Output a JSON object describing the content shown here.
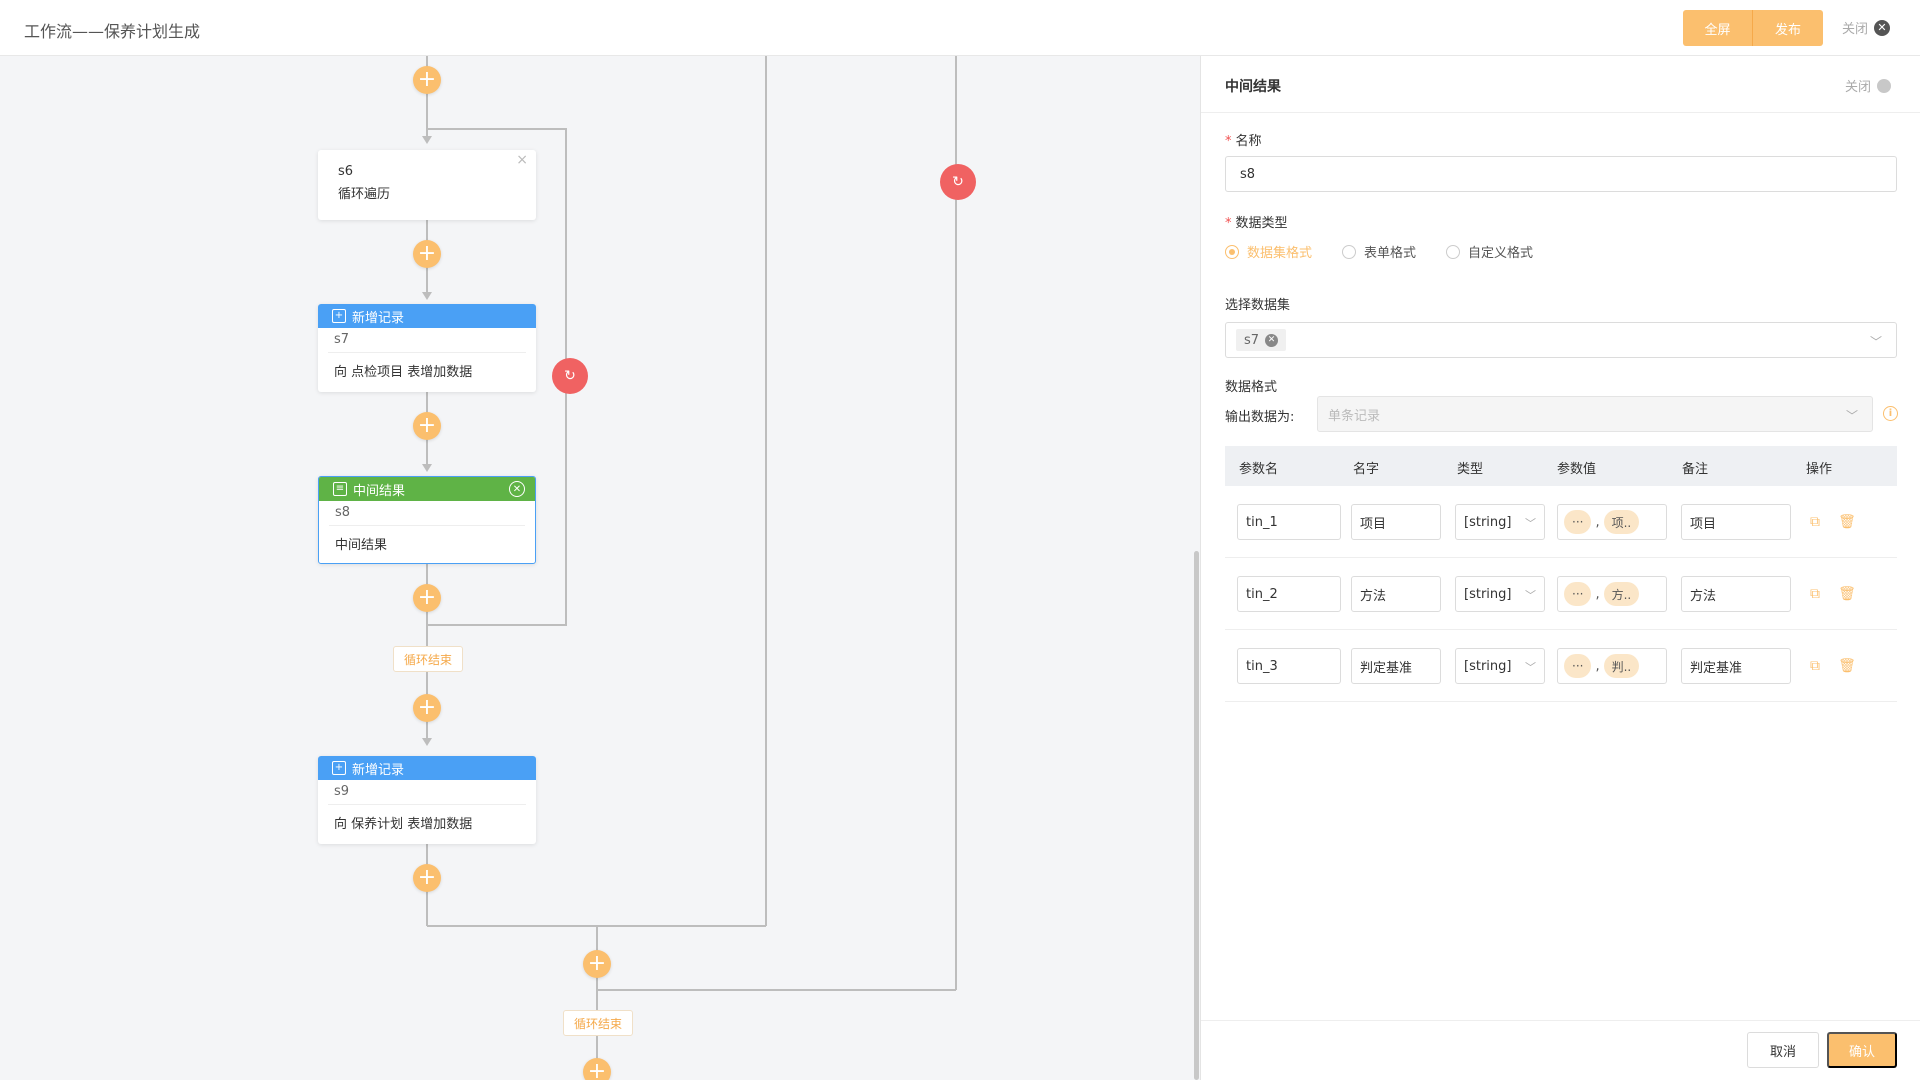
{
  "header": {
    "title": "工作流——保养计划生成",
    "fullscreen_label": "全屏",
    "publish_label": "发布",
    "close_label": "关闭"
  },
  "canvas": {
    "nodes": {
      "s6": {
        "id": "s6",
        "desc": "循环遍历"
      },
      "s7": {
        "type_label": "新增记录",
        "id": "s7",
        "desc": "向 点检项目 表增加数据"
      },
      "s8": {
        "type_label": "中间结果",
        "id": "s8",
        "desc": "中间结果"
      },
      "s9": {
        "type_label": "新增记录",
        "id": "s9",
        "desc": "向 保养计划 表增加数据"
      }
    },
    "loop_end_label": "循环结束",
    "colors": {
      "plus": "#fbbf6e",
      "loop": "#f06262",
      "blue_head": "#4aa0f5",
      "green_head": "#5fb346"
    }
  },
  "panel": {
    "title": "中间结果",
    "close_label": "关闭",
    "name_label": "名称",
    "name_value": "s8",
    "datatype_label": "数据类型",
    "datatype_options": [
      "数据集格式",
      "表单格式",
      "自定义格式"
    ],
    "datatype_selected": "数据集格式",
    "dataset_label": "选择数据集",
    "dataset_tag": "s7",
    "format_label": "数据格式",
    "output_label": "输出数据为:",
    "output_placeholder": "单条记录",
    "table": {
      "headers": [
        "参数名",
        "名字",
        "类型",
        "参数值",
        "备注",
        "操作"
      ],
      "rows": [
        {
          "param": "tin_1",
          "name": "项目",
          "type": "[string]",
          "val_a": "···",
          "val_b": "项..",
          "note": "项目"
        },
        {
          "param": "tin_2",
          "name": "方法",
          "type": "[string]",
          "val_a": "···",
          "val_b": "方..",
          "note": "方法"
        },
        {
          "param": "tin_3",
          "name": "判定基准",
          "type": "[string]",
          "val_a": "···",
          "val_b": "判..",
          "note": "判定基准"
        }
      ]
    },
    "cancel_label": "取消",
    "confirm_label": "确认",
    "accent": "#fbbf6e"
  }
}
